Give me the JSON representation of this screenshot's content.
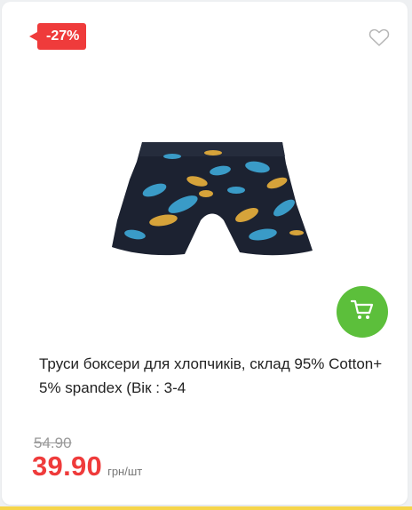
{
  "product": {
    "discount_badge": "-27%",
    "title": "Труси боксери для хлопчиків, склад 95% Cotton+ 5% spandex (Вік : 3-4",
    "old_price": "54.90",
    "price": "39.90",
    "unit": "грн/шт",
    "image_alt": "Дитячі труси-боксери з динозаврами"
  },
  "icons": {
    "favorite": "heart-outline-icon",
    "cart": "shopping-cart-icon"
  },
  "colors": {
    "accent_red": "#ef3b3b",
    "cart_green": "#5cbf3b",
    "boxer_navy": "#1c2231",
    "dino_blue": "#3a9bc7",
    "dino_yellow": "#d6a33a"
  }
}
